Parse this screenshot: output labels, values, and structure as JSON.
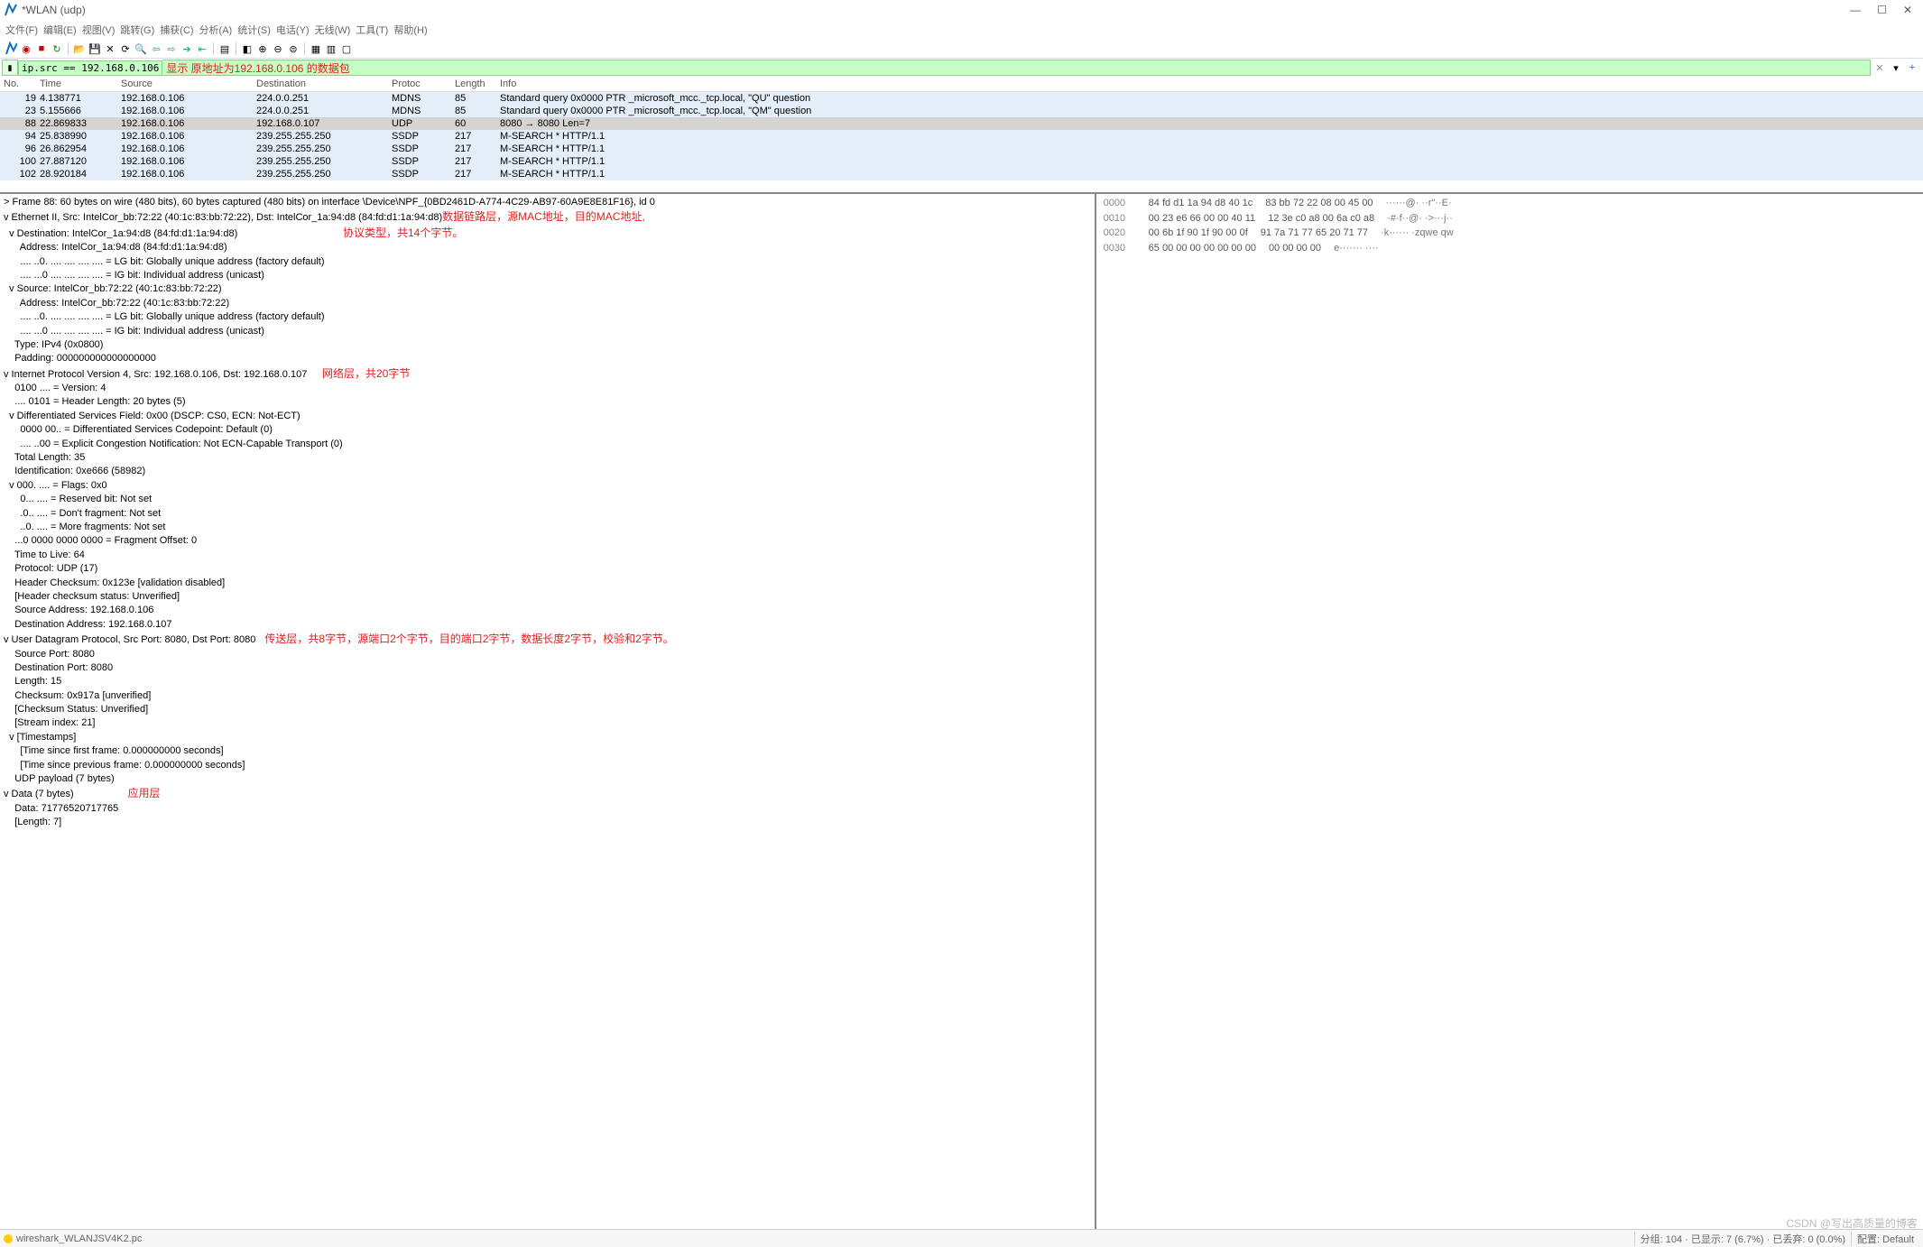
{
  "title": "*WLAN (udp)",
  "menu": [
    "文件(F)",
    "编辑(E)",
    "视图(V)",
    "跳转(G)",
    "捕获(C)",
    "分析(A)",
    "统计(S)",
    "电话(Y)",
    "无线(W)",
    "工具(T)",
    "帮助(H)"
  ],
  "window_buttons": {
    "min": "—",
    "max": "☐",
    "close": "✕"
  },
  "toolbar_icons": [
    "fin",
    "folder",
    "save",
    "close",
    "reload",
    "search",
    "back",
    "fwd",
    "goto",
    "end",
    "prev",
    "next",
    "sep",
    "auto",
    "sep",
    "size1",
    "size2",
    "size3",
    "sep",
    "cfg",
    "plus",
    "minus",
    "eq",
    "sep",
    "paint",
    "filter",
    "grid"
  ],
  "filter": {
    "value": "ip.src == 192.168.0.106",
    "anno": "显示 原地址为192.168.0.106 的数据包",
    "clear": "✕",
    "dd": "▾",
    "add": "+"
  },
  "pl_headers": [
    "No.",
    "Time",
    "Source",
    "Destination",
    "Protoc",
    "Length",
    "Info"
  ],
  "packets": [
    {
      "no": "19",
      "time": "4.138771",
      "src": "192.168.0.106",
      "dst": "224.0.0.251",
      "proto": "MDNS",
      "len": "85",
      "info": "Standard query 0x0000 PTR _microsoft_mcc._tcp.local, \"QU\" question",
      "cls": "blue"
    },
    {
      "no": "23",
      "time": "5.155666",
      "src": "192.168.0.106",
      "dst": "224.0.0.251",
      "proto": "MDNS",
      "len": "85",
      "info": "Standard query 0x0000 PTR _microsoft_mcc._tcp.local, \"QM\" question",
      "cls": "blue"
    },
    {
      "no": "88",
      "time": "22.869833",
      "src": "192.168.0.106",
      "dst": "192.168.0.107",
      "proto": "UDP",
      "len": "60",
      "info": "8080 → 8080 Len=7",
      "cls": "sel"
    },
    {
      "no": "94",
      "time": "25.838990",
      "src": "192.168.0.106",
      "dst": "239.255.255.250",
      "proto": "SSDP",
      "len": "217",
      "info": "M-SEARCH * HTTP/1.1",
      "cls": "blue"
    },
    {
      "no": "96",
      "time": "26.862954",
      "src": "192.168.0.106",
      "dst": "239.255.255.250",
      "proto": "SSDP",
      "len": "217",
      "info": "M-SEARCH * HTTP/1.1",
      "cls": "blue"
    },
    {
      "no": "100",
      "time": "27.887120",
      "src": "192.168.0.106",
      "dst": "239.255.255.250",
      "proto": "SSDP",
      "len": "217",
      "info": "M-SEARCH * HTTP/1.1",
      "cls": "blue"
    },
    {
      "no": "102",
      "time": "28.920184",
      "src": "192.168.0.106",
      "dst": "239.255.255.250",
      "proto": "SSDP",
      "len": "217",
      "info": "M-SEARCH * HTTP/1.1",
      "cls": "blue"
    }
  ],
  "tree": [
    {
      "pfx": "> ",
      "txt": "Frame 88: 60 bytes on wire (480 bits), 60 bytes captured (480 bits) on interface \\Device\\NPF_{0BD2461D-A774-4C29-AB97-60A9E8E81F16}, id 0"
    },
    {
      "pfx": "v ",
      "txt": "Ethernet II, Src: IntelCor_bb:72:22 (40:1c:83:bb:72:22), Dst: IntelCor_1a:94:d8 (84:fd:d1:1a:94:d8)",
      "anno": "数据链路层，源MAC地址，目的MAC地址,"
    },
    {
      "pfx": "  v ",
      "txt": "Destination: IntelCor_1a:94:d8 (84:fd:d1:1a:94:d8)",
      "anno": "                                   协议类型，共14个字节。"
    },
    {
      "pfx": "      ",
      "txt": "Address: IntelCor_1a:94:d8 (84:fd:d1:1a:94:d8)"
    },
    {
      "pfx": "      ",
      "txt": ".... ..0. .... .... .... .... = LG bit: Globally unique address (factory default)"
    },
    {
      "pfx": "      ",
      "txt": ".... ...0 .... .... .... .... = IG bit: Individual address (unicast)"
    },
    {
      "pfx": "  v ",
      "txt": "Source: IntelCor_bb:72:22 (40:1c:83:bb:72:22)"
    },
    {
      "pfx": "      ",
      "txt": "Address: IntelCor_bb:72:22 (40:1c:83:bb:72:22)"
    },
    {
      "pfx": "      ",
      "txt": ".... ..0. .... .... .... .... = LG bit: Globally unique address (factory default)"
    },
    {
      "pfx": "      ",
      "txt": ".... ...0 .... .... .... .... = IG bit: Individual address (unicast)"
    },
    {
      "pfx": "    ",
      "txt": "Type: IPv4 (0x0800)"
    },
    {
      "pfx": "    ",
      "txt": "Padding: 000000000000000000"
    },
    {
      "pfx": "v ",
      "txt": "Internet Protocol Version 4, Src: 192.168.0.106, Dst: 192.168.0.107",
      "anno": "     网络层，共20字节"
    },
    {
      "pfx": "    ",
      "txt": "0100 .... = Version: 4"
    },
    {
      "pfx": "    ",
      "txt": ".... 0101 = Header Length: 20 bytes (5)"
    },
    {
      "pfx": "  v ",
      "txt": "Differentiated Services Field: 0x00 (DSCP: CS0, ECN: Not-ECT)"
    },
    {
      "pfx": "      ",
      "txt": "0000 00.. = Differentiated Services Codepoint: Default (0)"
    },
    {
      "pfx": "      ",
      "txt": ".... ..00 = Explicit Congestion Notification: Not ECN-Capable Transport (0)"
    },
    {
      "pfx": "    ",
      "txt": "Total Length: 35"
    },
    {
      "pfx": "    ",
      "txt": "Identification: 0xe666 (58982)"
    },
    {
      "pfx": "  v ",
      "txt": "000. .... = Flags: 0x0"
    },
    {
      "pfx": "      ",
      "txt": "0... .... = Reserved bit: Not set"
    },
    {
      "pfx": "      ",
      "txt": ".0.. .... = Don't fragment: Not set"
    },
    {
      "pfx": "      ",
      "txt": "..0. .... = More fragments: Not set"
    },
    {
      "pfx": "    ",
      "txt": "...0 0000 0000 0000 = Fragment Offset: 0"
    },
    {
      "pfx": "    ",
      "txt": "Time to Live: 64"
    },
    {
      "pfx": "    ",
      "txt": "Protocol: UDP (17)"
    },
    {
      "pfx": "    ",
      "txt": "Header Checksum: 0x123e [validation disabled]"
    },
    {
      "pfx": "    ",
      "txt": "[Header checksum status: Unverified]"
    },
    {
      "pfx": "    ",
      "txt": "Source Address: 192.168.0.106"
    },
    {
      "pfx": "    ",
      "txt": "Destination Address: 192.168.0.107"
    },
    {
      "pfx": "v ",
      "txt": "User Datagram Protocol, Src Port: 8080, Dst Port: 8080",
      "anno": "   传送层，共8字节，源端口2个字节，目的端口2字节，数据长度2字节，校验和2字节。"
    },
    {
      "pfx": "    ",
      "txt": "Source Port: 8080"
    },
    {
      "pfx": "    ",
      "txt": "Destination Port: 8080"
    },
    {
      "pfx": "    ",
      "txt": "Length: 15"
    },
    {
      "pfx": "    ",
      "txt": "Checksum: 0x917a [unverified]"
    },
    {
      "pfx": "    ",
      "txt": "[Checksum Status: Unverified]"
    },
    {
      "pfx": "    ",
      "txt": "[Stream index: 21]"
    },
    {
      "pfx": "  v ",
      "txt": "[Timestamps]"
    },
    {
      "pfx": "      ",
      "txt": "[Time since first frame: 0.000000000 seconds]"
    },
    {
      "pfx": "      ",
      "txt": "[Time since previous frame: 0.000000000 seconds]"
    },
    {
      "pfx": "    ",
      "txt": "UDP payload (7 bytes)"
    },
    {
      "pfx": "v ",
      "txt": "Data (7 bytes)",
      "anno": "                  应用层"
    },
    {
      "pfx": "    ",
      "txt": "Data: 71776520717765"
    },
    {
      "pfx": "    ",
      "txt": "[Length: 7]"
    }
  ],
  "hex": [
    {
      "off": "0000",
      "b1": "84 fd d1 1a 94 d8 40 1c",
      "b2": "83 bb 72 22 08 00 45 00",
      "asc": "······@· ··r\"··E·"
    },
    {
      "off": "0010",
      "b1": "00 23 e6 66 00 00 40 11",
      "b2": "12 3e c0 a8 00 6a c0 a8",
      "asc": "·#·f··@· ·>···j··"
    },
    {
      "off": "0020",
      "b1": "00 6b 1f 90 1f 90 00 0f",
      "b2": "91 7a 71 77 65 20 71 77",
      "asc": "·k······ ·zqwe qw"
    },
    {
      "off": "0030",
      "b1": "65 00 00 00 00 00 00 00",
      "b2": "00 00 00 00",
      "asc": "e······· ····"
    }
  ],
  "status": {
    "file": "wireshark_WLANJSV4K2.pc",
    "pkts": "分组: 104 · 已显示: 7 (6.7%) · 已丢弃: 0 (0.0%)",
    "profile": "配置: Default"
  },
  "watermark": "CSDN @写出高质量的博客"
}
